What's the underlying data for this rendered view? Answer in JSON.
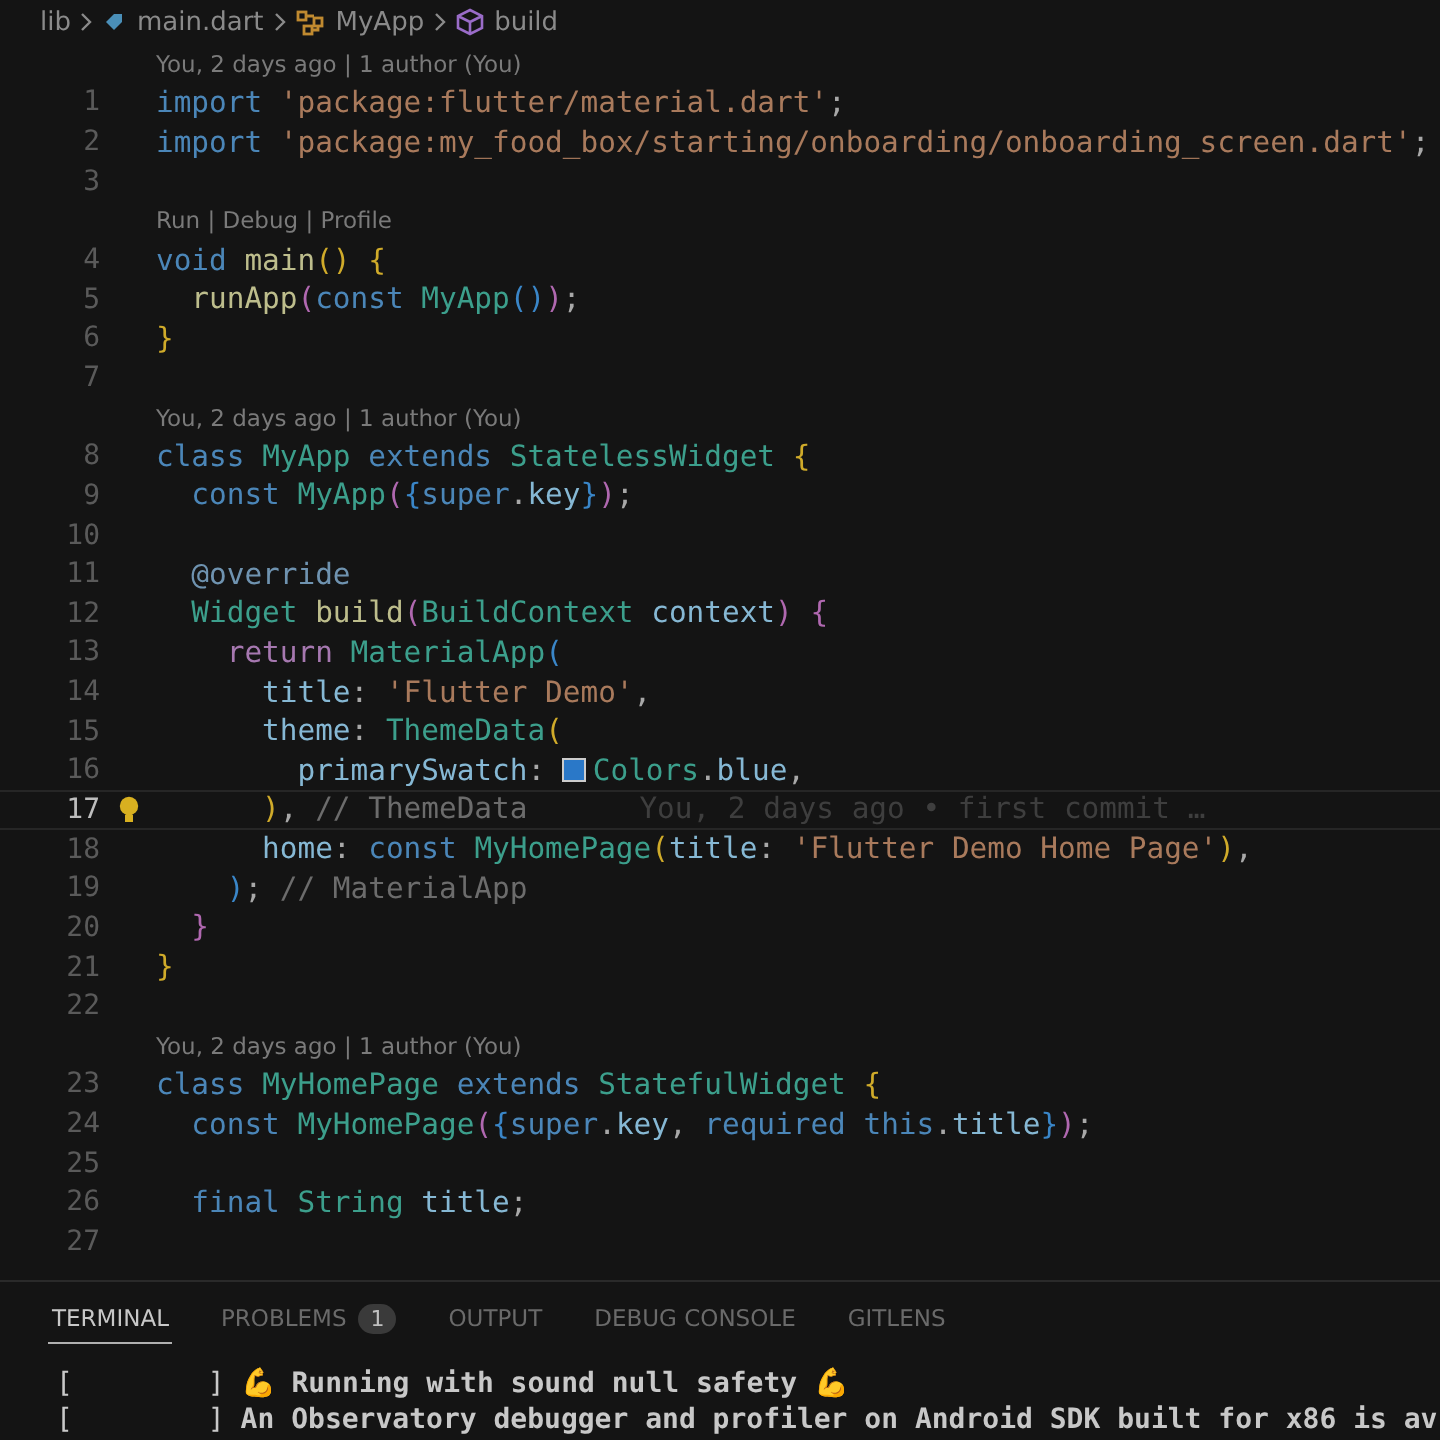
{
  "breadcrumb": [
    {
      "kind": "folder",
      "label": "lib"
    },
    {
      "kind": "file",
      "label": "main.dart"
    },
    {
      "kind": "class",
      "label": "MyApp"
    },
    {
      "kind": "method",
      "label": "build"
    }
  ],
  "lines": [
    {
      "kind": "lens",
      "text": "You, 2 days ago | 1 author (You)"
    },
    {
      "kind": "code",
      "number": "1",
      "current": false,
      "tokens": [
        {
          "kind": "kw",
          "text": "import "
        },
        {
          "kind": "str",
          "text": "'package:flutter/material.dart'"
        },
        {
          "kind": "plain",
          "text": ";"
        }
      ]
    },
    {
      "kind": "code",
      "number": "2",
      "current": false,
      "tokens": [
        {
          "kind": "kw",
          "text": "import "
        },
        {
          "kind": "str",
          "text": "'package:my_food_box/starting/onboarding/onboarding_screen.dart'"
        },
        {
          "kind": "plain",
          "text": ";"
        }
      ]
    },
    {
      "kind": "code",
      "number": "3",
      "current": false
    },
    {
      "kind": "lens",
      "text": "Run | Debug | Profile"
    },
    {
      "kind": "code",
      "number": "4",
      "current": false,
      "tokens": [
        {
          "kind": "kw",
          "text": "void "
        },
        {
          "kind": "fn",
          "text": "main"
        },
        {
          "kind": "br1",
          "text": "() {"
        }
      ]
    },
    {
      "kind": "code",
      "number": "5",
      "current": false,
      "tokens": [
        {
          "kind": "fn",
          "text": "  runApp"
        },
        {
          "kind": "br2",
          "text": "("
        },
        {
          "kind": "kw",
          "text": "const "
        },
        {
          "kind": "type",
          "text": "MyApp"
        },
        {
          "kind": "br3",
          "text": "()"
        },
        {
          "kind": "br2",
          "text": ")"
        },
        {
          "kind": "plain",
          "text": ";"
        }
      ]
    },
    {
      "kind": "code",
      "number": "6",
      "current": false,
      "tokens": [
        {
          "kind": "br1",
          "text": "}"
        }
      ]
    },
    {
      "kind": "code",
      "number": "7",
      "current": false
    },
    {
      "kind": "lens",
      "text": "You, 2 days ago | 1 author (You)"
    },
    {
      "kind": "code",
      "number": "8",
      "current": false,
      "tokens": [
        {
          "kind": "kw",
          "text": "class "
        },
        {
          "kind": "type",
          "text": "MyApp "
        },
        {
          "kind": "kw",
          "text": "extends "
        },
        {
          "kind": "type",
          "text": "StatelessWidget "
        },
        {
          "kind": "br1",
          "text": "{"
        }
      ]
    },
    {
      "kind": "code",
      "number": "9",
      "current": false,
      "tokens": [
        {
          "kind": "kw",
          "text": "  const "
        },
        {
          "kind": "type",
          "text": "MyApp"
        },
        {
          "kind": "br2",
          "text": "("
        },
        {
          "kind": "br3",
          "text": "{"
        },
        {
          "kind": "kw",
          "text": "super"
        },
        {
          "kind": "plain",
          "text": "."
        },
        {
          "kind": "var",
          "text": "key"
        },
        {
          "kind": "br3",
          "text": "}"
        },
        {
          "kind": "br2",
          "text": ")"
        },
        {
          "kind": "plain",
          "text": ";"
        }
      ]
    },
    {
      "kind": "code",
      "number": "10",
      "current": false
    },
    {
      "kind": "code",
      "number": "11",
      "current": false,
      "tokens": [
        {
          "kind": "ann",
          "text": "  @override"
        }
      ]
    },
    {
      "kind": "code",
      "number": "12",
      "current": false,
      "tokens": [
        {
          "kind": "type",
          "text": "  Widget "
        },
        {
          "kind": "fn",
          "text": "build"
        },
        {
          "kind": "br2",
          "text": "("
        },
        {
          "kind": "type",
          "text": "BuildContext "
        },
        {
          "kind": "var",
          "text": "context"
        },
        {
          "kind": "br2",
          "text": ") {"
        }
      ]
    },
    {
      "kind": "code",
      "number": "13",
      "current": false,
      "tokens": [
        {
          "kind": "ctl",
          "text": "    return "
        },
        {
          "kind": "type",
          "text": "MaterialApp"
        },
        {
          "kind": "br3",
          "text": "("
        }
      ]
    },
    {
      "kind": "code",
      "number": "14",
      "current": false,
      "tokens": [
        {
          "kind": "var",
          "text": "      title"
        },
        {
          "kind": "plain",
          "text": ": "
        },
        {
          "kind": "str",
          "text": "'Flutter Demo'"
        },
        {
          "kind": "plain",
          "text": ","
        }
      ]
    },
    {
      "kind": "code",
      "number": "15",
      "current": false,
      "tokens": [
        {
          "kind": "var",
          "text": "      theme"
        },
        {
          "kind": "plain",
          "text": ": "
        },
        {
          "kind": "type",
          "text": "ThemeData"
        },
        {
          "kind": "br1",
          "text": "("
        }
      ]
    },
    {
      "kind": "code",
      "number": "16",
      "current": false,
      "tokens": [
        {
          "kind": "var",
          "text": "        primarySwatch"
        },
        {
          "kind": "plain",
          "text": ": "
        },
        {
          "kind": "swatch",
          "color": "#2a78c8"
        },
        {
          "kind": "type",
          "text": "Colors"
        },
        {
          "kind": "plain",
          "text": "."
        },
        {
          "kind": "var",
          "text": "blue"
        },
        {
          "kind": "plain",
          "text": ","
        }
      ]
    },
    {
      "kind": "code",
      "number": "17",
      "current": true,
      "lightbulb": true,
      "blame": "You, 2 days ago • first commit …",
      "tokens": [
        {
          "kind": "br1",
          "text": "      )"
        },
        {
          "kind": "plain",
          "text": ", "
        },
        {
          "kind": "cmt",
          "text": "// ThemeData"
        }
      ]
    },
    {
      "kind": "code",
      "number": "18",
      "current": false,
      "tokens": [
        {
          "kind": "var",
          "text": "      home"
        },
        {
          "kind": "plain",
          "text": ": "
        },
        {
          "kind": "kw",
          "text": "const "
        },
        {
          "kind": "type",
          "text": "MyHomePage"
        },
        {
          "kind": "br1",
          "text": "("
        },
        {
          "kind": "var",
          "text": "title"
        },
        {
          "kind": "plain",
          "text": ": "
        },
        {
          "kind": "str",
          "text": "'Flutter Demo Home Page'"
        },
        {
          "kind": "br1",
          "text": ")"
        },
        {
          "kind": "plain",
          "text": ","
        }
      ]
    },
    {
      "kind": "code",
      "number": "19",
      "current": false,
      "tokens": [
        {
          "kind": "br3",
          "text": "    )"
        },
        {
          "kind": "plain",
          "text": "; "
        },
        {
          "kind": "cmt",
          "text": "// MaterialApp"
        }
      ]
    },
    {
      "kind": "code",
      "number": "20",
      "current": false,
      "tokens": [
        {
          "kind": "br2",
          "text": "  }"
        }
      ]
    },
    {
      "kind": "code",
      "number": "21",
      "current": false,
      "tokens": [
        {
          "kind": "br1",
          "text": "}"
        }
      ]
    },
    {
      "kind": "code",
      "number": "22",
      "current": false
    },
    {
      "kind": "lens",
      "text": "You, 2 days ago | 1 author (You)"
    },
    {
      "kind": "code",
      "number": "23",
      "current": false,
      "tokens": [
        {
          "kind": "kw",
          "text": "class "
        },
        {
          "kind": "type",
          "text": "MyHomePage "
        },
        {
          "kind": "kw",
          "text": "extends "
        },
        {
          "kind": "type",
          "text": "StatefulWidget "
        },
        {
          "kind": "br1",
          "text": "{"
        }
      ]
    },
    {
      "kind": "code",
      "number": "24",
      "current": false,
      "tokens": [
        {
          "kind": "kw",
          "text": "  const "
        },
        {
          "kind": "type",
          "text": "MyHomePage"
        },
        {
          "kind": "br2",
          "text": "("
        },
        {
          "kind": "br3",
          "text": "{"
        },
        {
          "kind": "kw",
          "text": "super"
        },
        {
          "kind": "plain",
          "text": "."
        },
        {
          "kind": "var",
          "text": "key"
        },
        {
          "kind": "plain",
          "text": ", "
        },
        {
          "kind": "kw",
          "text": "required this"
        },
        {
          "kind": "plain",
          "text": "."
        },
        {
          "kind": "var",
          "text": "title"
        },
        {
          "kind": "br3",
          "text": "}"
        },
        {
          "kind": "br2",
          "text": ")"
        },
        {
          "kind": "plain",
          "text": ";"
        }
      ]
    },
    {
      "kind": "code",
      "number": "25",
      "current": false
    },
    {
      "kind": "code",
      "number": "26",
      "current": false,
      "tokens": [
        {
          "kind": "kw",
          "text": "  final "
        },
        {
          "kind": "type",
          "text": "String "
        },
        {
          "kind": "var",
          "text": "title"
        },
        {
          "kind": "plain",
          "text": ";"
        }
      ]
    },
    {
      "kind": "code",
      "number": "27",
      "current": false
    }
  ],
  "panel": {
    "tabs": [
      {
        "label": "TERMINAL",
        "selected": true
      },
      {
        "label": "PROBLEMS",
        "selected": false,
        "badge": "1"
      },
      {
        "label": "OUTPUT",
        "selected": false
      },
      {
        "label": "DEBUG CONSOLE",
        "selected": false
      },
      {
        "label": "GITLENS",
        "selected": false
      }
    ],
    "terminal_lines": [
      {
        "prefix": "[        ]",
        "text": "💪 Running with sound null safety 💪"
      },
      {
        "prefix": "[        ]",
        "text": "An Observatory debugger and profiler on Android SDK built for x86 is av"
      }
    ]
  }
}
